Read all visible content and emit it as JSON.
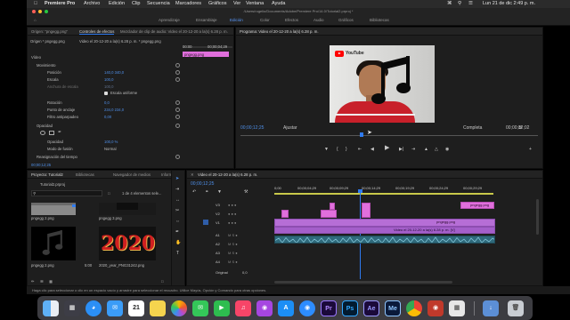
{
  "menubar": {
    "app_name": "Premiere Pro",
    "items": [
      "Archivo",
      "Edición",
      "Clip",
      "Secuencia",
      "Marcadores",
      "Gráficos",
      "Ver",
      "Ventana",
      "Ayuda"
    ],
    "clock": "Lun 21 de dic  2:49 p. m."
  },
  "window": {
    "title": "/Users/rogelio/Documents/Adobe/Premiere Pro/14.0/Tutorial2.prproj *"
  },
  "workspaces": [
    "Aprendizaje",
    "Ensamblaje",
    "Edición",
    "Color",
    "Efectos",
    "Audio",
    "Gráficos",
    "Bibliotecas"
  ],
  "workspace_active": "Edición",
  "effects_panel": {
    "tabs": [
      "Origen: \"pngegg.png\"",
      "Controles de efectos",
      "Mezclador de clip de audio: Video el 20-12-20 a la(s) 6.28 p. m."
    ],
    "source_label": "Origen * pngegg.png",
    "clip_label": "Video el 20-12-20 a la(s) 6.28 p. m. * pngegg.png",
    "mini_clip": "pngegg.png",
    "ruler_start": "00:00",
    "ruler_end": "00;00;04;29",
    "section_video": "Vídeo",
    "motion": "Movimiento",
    "rows": [
      {
        "label": "Posición",
        "value": "140,0   340,0"
      },
      {
        "label": "Escala",
        "value": "100,0"
      },
      {
        "label": "Anchura de escala",
        "value": "100,0"
      },
      {
        "label": "Escala uniforme",
        "value": ""
      },
      {
        "label": "Rotación",
        "value": "0,0"
      },
      {
        "label": "Punto de anclaje",
        "value": "234,0   234,0"
      },
      {
        "label": "Filtro antiparpadeo",
        "value": "0,00"
      }
    ],
    "opacity": "Opacidad",
    "opacity_value_label": "Opacidad",
    "opacity_value": "100,0 %",
    "blend_label": "Modo de fusión",
    "blend_value": "Normal",
    "time_remap": "Reasignación del tiempo",
    "timecode": "00;00;12;25"
  },
  "program_monitor": {
    "title": "Programa: Video el 20-12-20 a la(s) 6.28 p. m.",
    "timecode": "00;00;12;25",
    "fit": "Ajustar",
    "quality": "Completa",
    "duration": "00;00;32;02"
  },
  "project_panel": {
    "tabs": [
      "Proyecto: Tutorial2",
      "Bibliotecas",
      "Navegador de medios",
      "Información"
    ],
    "path": "Tutorial2.prproj",
    "selection": "1 de 4 elementos sele...",
    "items": [
      {
        "name": "pngegg 2.png",
        "duration": ""
      },
      {
        "name": "pngegg 3.png",
        "duration": ""
      },
      {
        "name": "pngegg 2.png",
        "duration": "5:00"
      },
      {
        "name": "2020_year_PNG31242.png",
        "duration": "5:00"
      }
    ],
    "year_text": "2020"
  },
  "timeline": {
    "title": "Video el 20-12-20 a la(s) 6.28 p. m.",
    "timecode": "00;00;12;25",
    "ruler": [
      "0;00",
      "00;00;04;29",
      "00;00;09;29",
      "00;00;14;29",
      "00;00;19;29",
      "00;00;24;29",
      "00;00;29;29"
    ],
    "tracks_video": [
      "V3",
      "V2",
      "V1"
    ],
    "tracks_audio": [
      "A1",
      "A2",
      "A3",
      "A4"
    ],
    "master": "Original",
    "master_value": "0,0",
    "clips": {
      "v3_main": "pngegg.png",
      "v2_clip": "pngegg.png",
      "v1_video": "Video el 20-12-20 a la(s) 6.28 p. m. [V]"
    }
  },
  "status_bar": {
    "text": "Haga clic para seleccionar o clic en un espacio vacío y arrastre para seleccionar el recuadro. Utilice Mayús, Opción y Comando para otras opciones."
  },
  "dock": {
    "apps": [
      "Finder",
      "Launchpad",
      "Safari",
      "Mail",
      "Calendar",
      "Notes",
      "Photos",
      "Messages",
      "FaceTime",
      "Music",
      "Podcasts",
      "App Store",
      "Zoom",
      "Premiere Pro",
      "Photoshop",
      "After Effects",
      "Media Encoder",
      "Chrome",
      "Photo Booth",
      "Preview",
      "Trash"
    ],
    "calendar_day": "21",
    "labels": {
      "pr": "Pr",
      "ps": "Ps",
      "ae": "Ae",
      "me": "Me"
    }
  },
  "colors": {
    "accent_blue": "#2f7bf0",
    "clip_pink": "#e06fdc",
    "clip_violet": "#b66ed6",
    "audio_teal": "#2f6a7c",
    "youtube_red": "#ff0000"
  }
}
